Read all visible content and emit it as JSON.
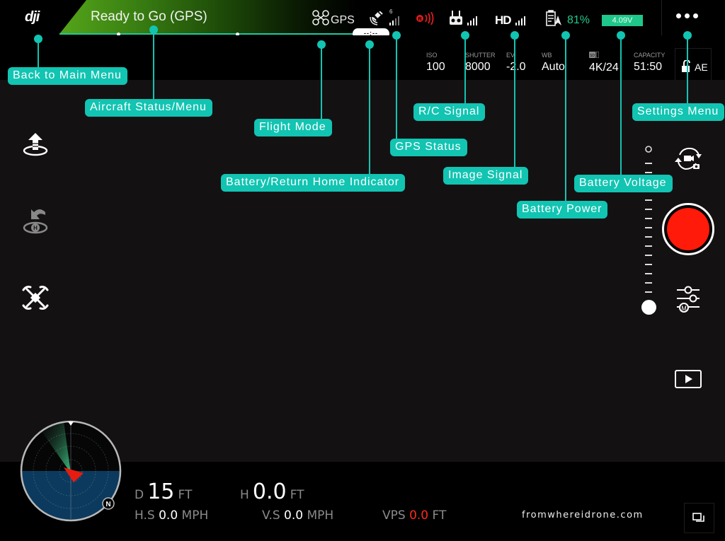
{
  "app": {
    "logo": "dji",
    "status": "Ready to Go (GPS)",
    "flight_mode": "GPS",
    "gps_satellites": "6",
    "battery_return_indicator": "--:--",
    "battery_percent": "81%",
    "battery_voltage": "4.09V",
    "image_link": "HD"
  },
  "colors": {
    "accent_callout": "#12c4b2",
    "status_green": "#55a51a",
    "battery_green": "#1fc88a",
    "record_red": "#ff1a0a",
    "vps_red": "#ff2a1a",
    "radar_blue": "#0c3a5e"
  },
  "camera": {
    "params": [
      {
        "label": "ISO",
        "value": "100"
      },
      {
        "label": "SHUTTER",
        "value": "8000"
      },
      {
        "label": "EV",
        "value": "-2.0"
      },
      {
        "label": "WB",
        "value": "Auto"
      },
      {
        "label": "SD",
        "value": "4K/24"
      },
      {
        "label": "CAPACITY",
        "value": "51:50"
      }
    ],
    "ae_lock": "AE"
  },
  "callouts": {
    "back": "Back to Main Menu",
    "aircraft_status": "Aircraft Status/Menu",
    "flight_mode": "Flight Mode",
    "battery_return": "Battery/Return Home Indicator",
    "gps_status": "GPS Status",
    "rc_signal": "R/C Signal",
    "image_signal": "Image Signal",
    "battery_power": "Battery Power",
    "battery_voltage": "Battery Voltage",
    "settings": "Settings Menu"
  },
  "left_toolbar": [
    {
      "icon": "takeoff-icon"
    },
    {
      "icon": "return-home-icon"
    },
    {
      "icon": "intelligent-flight-icon"
    }
  ],
  "right_toolbar": {
    "gimbal_zoom_level": 1.0,
    "modes": [
      "camera-switch-icon",
      "record-button",
      "camera-settings-icon",
      "playback-icon"
    ]
  },
  "telemetry": {
    "distance": {
      "label": "D",
      "value": "15",
      "unit": "FT"
    },
    "height": {
      "label": "H",
      "value": "0.0",
      "unit": "FT"
    },
    "h_speed": {
      "label": "H.S",
      "value": "0.0",
      "unit": "MPH"
    },
    "v_speed": {
      "label": "V.S",
      "value": "0.0",
      "unit": "MPH"
    },
    "vps": {
      "label": "VPS",
      "value": "0.0",
      "unit": "FT"
    }
  },
  "radar": {
    "north_label": "N"
  },
  "watermark": "fromwhereidrone.com"
}
